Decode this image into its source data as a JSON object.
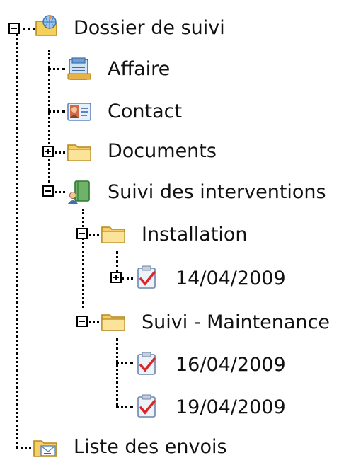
{
  "tree": {
    "root": {
      "label": "Dossier de suivi",
      "expanded": true,
      "icon": "folder-globe-icon"
    },
    "items": [
      {
        "label": "Affaire",
        "icon": "document-icon"
      },
      {
        "label": "Contact",
        "icon": "contact-card-icon"
      },
      {
        "label": "Documents",
        "icon": "folder-icon",
        "expanded": false
      },
      {
        "label": "Suivi des interventions",
        "icon": "book-user-icon",
        "expanded": true
      }
    ],
    "interventions": [
      {
        "label": "Installation",
        "icon": "folder-icon",
        "expanded": true
      },
      {
        "label": "Suivi - Maintenance",
        "icon": "folder-icon",
        "expanded": true
      }
    ],
    "installation_items": [
      {
        "label": "14/04/2009",
        "icon": "checklist-icon",
        "expanded": false
      }
    ],
    "maintenance_items": [
      {
        "label": "16/04/2009",
        "icon": "checklist-icon"
      },
      {
        "label": "19/04/2009",
        "icon": "checklist-icon"
      }
    ],
    "last": {
      "label": "Liste des envois",
      "icon": "folder-mail-icon"
    }
  }
}
